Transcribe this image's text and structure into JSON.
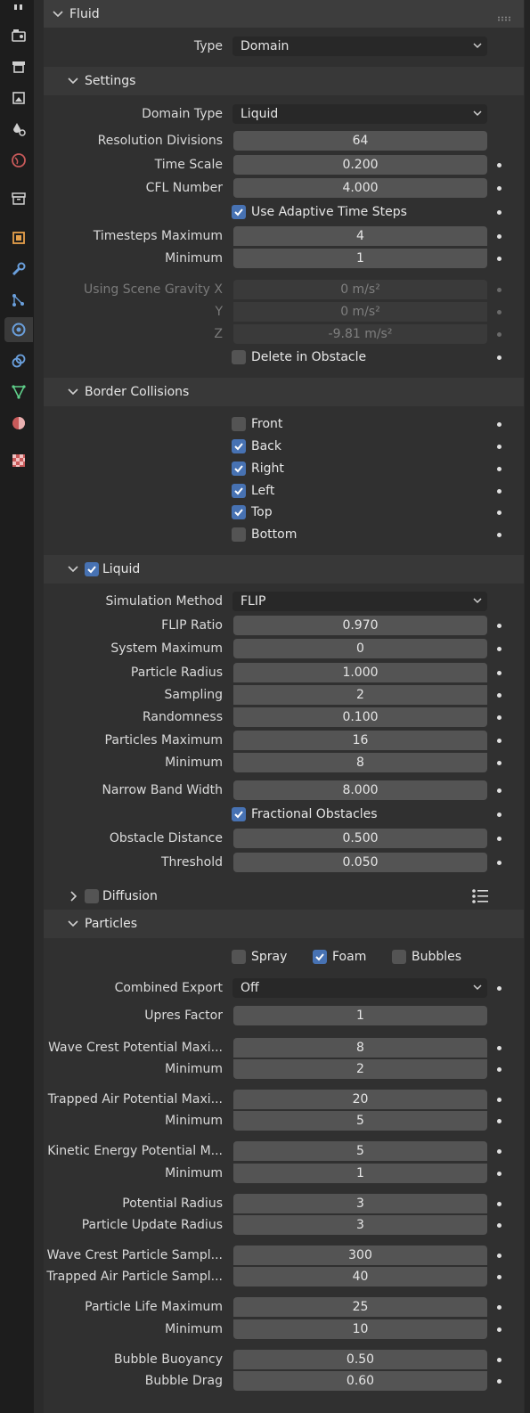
{
  "fluid": {
    "title": "Fluid",
    "type_label": "Type",
    "type_value": "Domain"
  },
  "settings": {
    "title": "Settings",
    "domain_type_label": "Domain Type",
    "domain_type_value": "Liquid",
    "resolution_label": "Resolution Divisions",
    "resolution_value": "64",
    "time_scale_label": "Time Scale",
    "time_scale_value": "0.200",
    "cfl_label": "CFL Number",
    "cfl_value": "4.000",
    "adaptive_label": "Use Adaptive Time Steps",
    "adaptive_checked": true,
    "timesteps_max_label": "Timesteps Maximum",
    "timesteps_max_value": "4",
    "timesteps_min_label": "Minimum",
    "timesteps_min_value": "1",
    "gravity_x_label": "Using Scene Gravity X",
    "gravity_x_value": "0 m/s²",
    "gravity_y_label": "Y",
    "gravity_y_value": "0 m/s²",
    "gravity_z_label": "Z",
    "gravity_z_value": "-9.81 m/s²",
    "delete_obstacle_label": "Delete in Obstacle",
    "delete_obstacle_checked": false
  },
  "border": {
    "title": "Border Collisions",
    "items": [
      {
        "label": "Front",
        "checked": false
      },
      {
        "label": "Back",
        "checked": true
      },
      {
        "label": "Right",
        "checked": true
      },
      {
        "label": "Left",
        "checked": true
      },
      {
        "label": "Top",
        "checked": true
      },
      {
        "label": "Bottom",
        "checked": false
      }
    ]
  },
  "liquid": {
    "title": "Liquid",
    "enabled": true,
    "sim_method_label": "Simulation Method",
    "sim_method_value": "FLIP",
    "flip_ratio_label": "FLIP Ratio",
    "flip_ratio_value": "0.970",
    "system_max_label": "System Maximum",
    "system_max_value": "0",
    "particle_radius_label": "Particle Radius",
    "particle_radius_value": "1.000",
    "sampling_label": "Sampling",
    "sampling_value": "2",
    "randomness_label": "Randomness",
    "randomness_value": "0.100",
    "particles_max_label": "Particles Maximum",
    "particles_max_value": "16",
    "particles_min_label": "Minimum",
    "particles_min_value": "8",
    "narrow_band_label": "Narrow Band Width",
    "narrow_band_value": "8.000",
    "fractional_label": "Fractional Obstacles",
    "fractional_checked": true,
    "obstacle_distance_label": "Obstacle Distance",
    "obstacle_distance_value": "0.500",
    "threshold_label": "Threshold",
    "threshold_value": "0.050"
  },
  "diffusion": {
    "title": "Diffusion",
    "enabled": false
  },
  "particles": {
    "title": "Particles",
    "spray_label": "Spray",
    "spray_checked": false,
    "foam_label": "Foam",
    "foam_checked": true,
    "bubbles_label": "Bubbles",
    "bubbles_checked": false,
    "combined_export_label": "Combined Export",
    "combined_export_value": "Off",
    "upres_label": "Upres Factor",
    "upres_value": "1",
    "wave_crest_max_label": "Wave Crest Potential Maxi...",
    "wave_crest_max_value": "8",
    "wave_crest_min_label": "Minimum",
    "wave_crest_min_value": "2",
    "trapped_air_max_label": "Trapped Air Potential Maxi...",
    "trapped_air_max_value": "20",
    "trapped_air_min_label": "Minimum",
    "trapped_air_min_value": "5",
    "kinetic_max_label": "Kinetic Energy Potential M...",
    "kinetic_max_value": "5",
    "kinetic_min_label": "Minimum",
    "kinetic_min_value": "1",
    "potential_radius_label": "Potential Radius",
    "potential_radius_value": "3",
    "update_radius_label": "Particle Update Radius",
    "update_radius_value": "3",
    "wave_crest_sampling_label": "Wave Crest Particle Sampl...",
    "wave_crest_sampling_value": "300",
    "trapped_air_sampling_label": "Trapped Air Particle Sampl...",
    "trapped_air_sampling_value": "40",
    "life_max_label": "Particle Life Maximum",
    "life_max_value": "25",
    "life_min_label": "Minimum",
    "life_min_value": "10",
    "bubble_buoyancy_label": "Bubble Buoyancy",
    "bubble_buoyancy_value": "0.50",
    "bubble_drag_label": "Bubble Drag",
    "bubble_drag_value": "0.60"
  },
  "sidebar_icons": [
    "render-icon",
    "output-icon",
    "view-layer-icon",
    "scene-icon",
    "world-icon",
    "collection-icon",
    "object-icon",
    "modifiers-icon",
    "particles-icon",
    "physics-icon",
    "constraints-icon",
    "data-icon",
    "material-icon",
    "texture-icon"
  ],
  "colors": {
    "accent": "#4772b3",
    "field": "#545454",
    "panel": "#303030",
    "header": "#383838"
  }
}
